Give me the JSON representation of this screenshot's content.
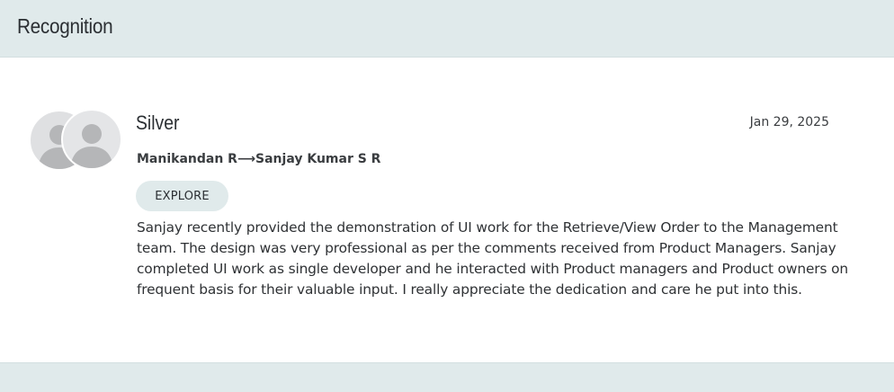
{
  "header": {
    "title": "Recognition"
  },
  "recognition": {
    "badge": "Silver",
    "date": "Jan 29, 2025",
    "from_to": "Manikandan R⟶Sanjay Kumar S R",
    "explore_label": "EXPLORE",
    "message": "Sanjay recently provided the demonstration of UI work for the Retrieve/View Order to the Management team. The design was very professional as per the comments received from Product Managers. Sanjay completed UI work as single developer and he interacted with Product managers and Product owners on frequent basis for their valuable input. I really appreciate the dedication and care he put into this."
  },
  "colors": {
    "header_bg": "#e0eaeb",
    "avatar_bg": "#dfe0e2",
    "avatar_fg": "#b5b6b8",
    "text": "#2b2f33"
  },
  "icons": {
    "giver_avatar": "user-silhouette-icon",
    "receiver_avatar": "user-silhouette-icon"
  }
}
